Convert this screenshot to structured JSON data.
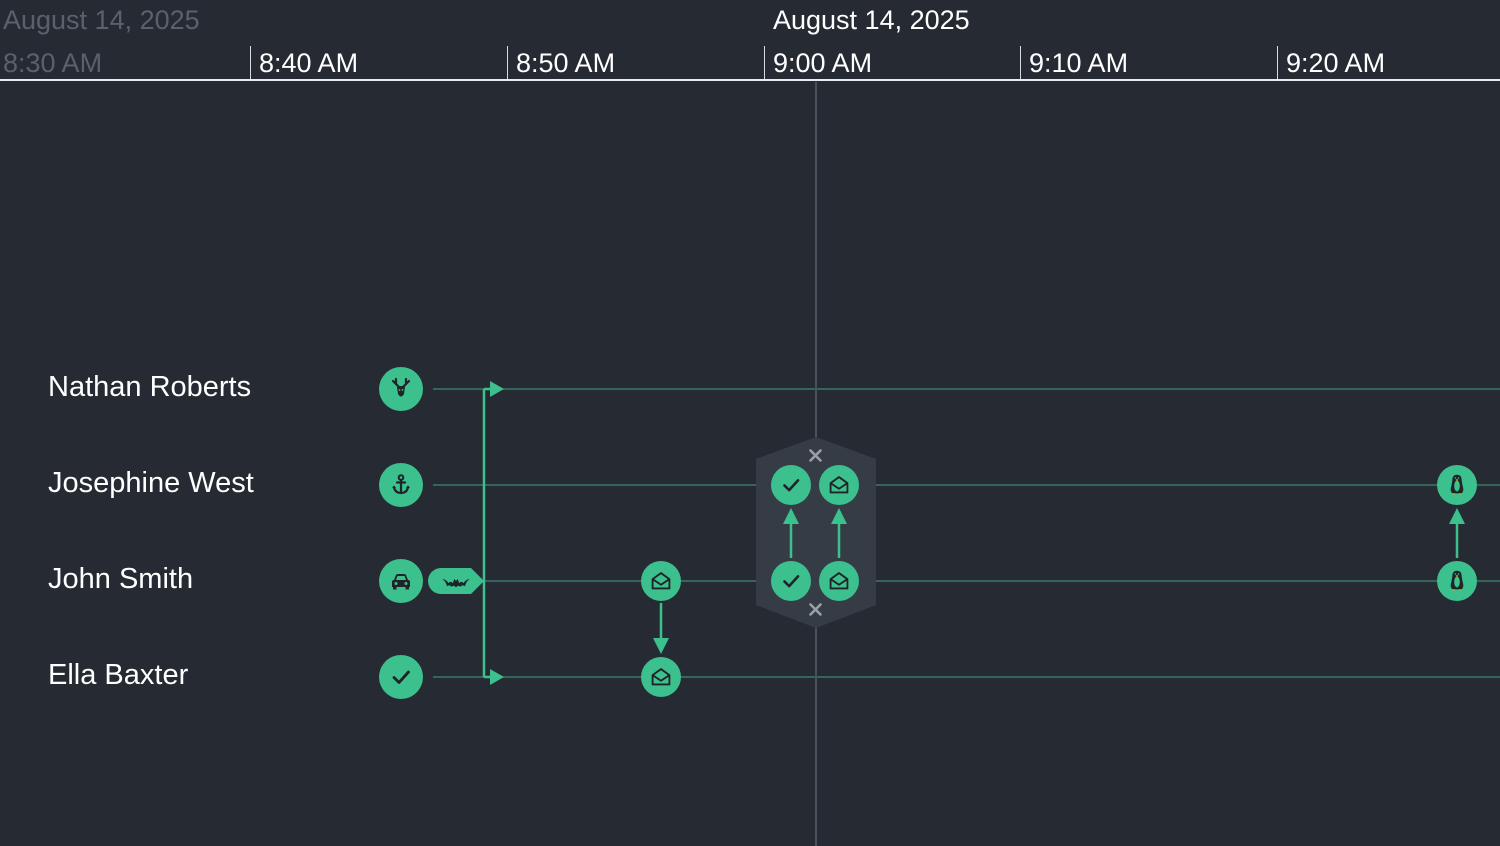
{
  "header": {
    "date_left": "August 14, 2025",
    "date_center": "August 14, 2025",
    "ticks": [
      {
        "label": "8:30 AM",
        "faded": true
      },
      {
        "label": "8:40 AM",
        "faded": false
      },
      {
        "label": "8:50 AM",
        "faded": false
      },
      {
        "label": "9:00 AM",
        "faded": false
      },
      {
        "label": "9:10 AM",
        "faded": false
      },
      {
        "label": "9:20 AM",
        "faded": false
      }
    ]
  },
  "lanes": [
    {
      "name": "Nathan Roberts",
      "icon": "deer-icon"
    },
    {
      "name": "Josephine West",
      "icon": "anchor-icon"
    },
    {
      "name": "John Smith",
      "icon": "car-icon"
    },
    {
      "name": "Ella Baxter",
      "icon": "check-icon"
    }
  ],
  "colors": {
    "background": "#262b33",
    "accent": "#3cc08d",
    "lane_line": "#3a7866",
    "cursor_line": "#4a515a",
    "group_fill": "#353c45",
    "close_mark": "#9aa0a6"
  },
  "events": {
    "branch_icon": "bat-icon",
    "email_icon": "envelope-icon",
    "approve_icon": "check-icon",
    "linux_icon": "penguin-icon",
    "close_icon": "close-icon"
  }
}
